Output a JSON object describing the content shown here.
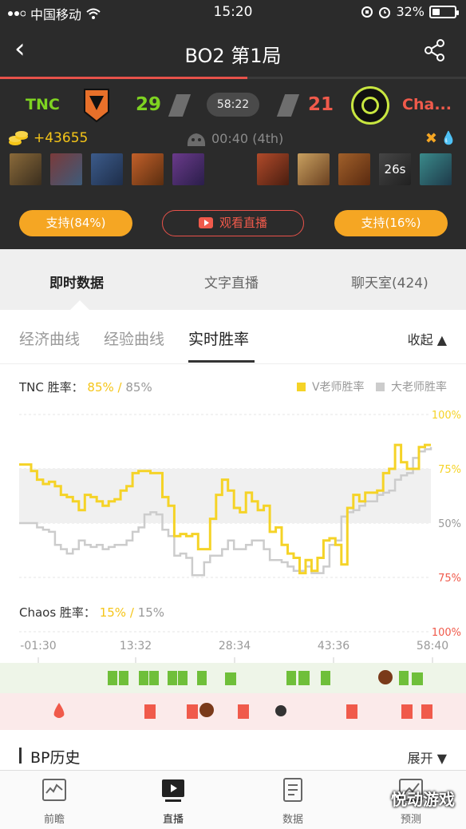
{
  "status_bar": {
    "carrier": "中国移动",
    "time": "15:20",
    "battery": "32%"
  },
  "nav": {
    "title": "BO2   第1局"
  },
  "match": {
    "team_left": "TNC",
    "team_right": "Cha...",
    "score_left": "29",
    "score_right": "21",
    "game_time": "58:22",
    "gold_lead": "+43655",
    "roshan_timer": "00:40 (4th)",
    "dead_timer": "26s"
  },
  "actions": {
    "support_left": "支持(84%)",
    "watch_live": "观看直播",
    "support_right": "支持(16%)"
  },
  "main_tabs": [
    "即时数据",
    "文字直播",
    "聊天室(424)"
  ],
  "sub_tabs": [
    "经济曲线",
    "经验曲线",
    "实时胜率"
  ],
  "collapse_label": "收起",
  "chart_labels": {
    "tnc_label": "TNC 胜率：",
    "tnc_v": "85%",
    "tnc_sep": "/",
    "tnc_d": "85%",
    "chaos_label": "Chaos 胜率：",
    "chaos_v": "15%",
    "chaos_sep": "/",
    "chaos_d": "15%",
    "legend_v": "V老师胜率",
    "legend_d": "大老师胜率"
  },
  "chart_data": {
    "type": "line",
    "y_ticks": [
      "100%",
      "75%",
      "50%",
      "75%",
      "100%"
    ],
    "x_ticks": [
      "-01:30",
      "13:32",
      "28:34",
      "43:36",
      "58:40"
    ],
    "grid": true,
    "series": [
      {
        "name": "V老师胜率",
        "color": "#f5d327",
        "values": [
          77,
          77,
          74,
          70,
          68,
          69,
          67,
          63,
          62,
          60,
          56,
          63,
          62,
          60,
          58,
          60,
          61,
          65,
          67,
          73,
          74,
          74,
          73,
          73,
          62,
          58,
          44,
          45,
          44,
          45,
          38,
          38,
          52,
          63,
          70,
          65,
          57,
          55,
          64,
          60,
          56,
          58,
          46,
          48,
          40,
          36,
          34,
          27,
          33,
          28,
          34,
          42,
          43,
          40,
          31,
          57,
          63,
          60,
          64,
          64,
          65,
          73,
          75,
          86,
          78,
          75,
          75,
          85,
          86,
          86
        ]
      },
      {
        "name": "大老师胜率",
        "color": "#cccccc",
        "values": [
          50,
          50,
          50,
          48,
          47,
          46,
          40,
          38,
          36,
          38,
          42,
          40,
          39,
          40,
          38,
          39,
          40,
          40,
          42,
          46,
          48,
          54,
          55,
          54,
          47,
          44,
          35,
          36,
          34,
          26,
          26,
          32,
          35,
          35,
          38,
          42,
          38,
          38,
          40,
          42,
          42,
          38,
          33,
          33,
          32,
          30,
          28,
          28,
          30,
          27,
          27,
          30,
          40,
          42,
          53,
          55,
          56,
          58,
          60,
          60,
          63,
          64,
          65,
          70,
          72,
          73,
          80,
          83,
          84,
          85
        ]
      }
    ]
  },
  "bp_history": {
    "label": "BP历史",
    "expand_label": "展开"
  },
  "tab_bar": [
    {
      "label": "前瞻",
      "icon": "chart-frame-icon"
    },
    {
      "label": "直播",
      "icon": "play-screen-icon"
    },
    {
      "label": "数据",
      "icon": "document-icon"
    },
    {
      "label": "预测",
      "icon": "trend-icon"
    }
  ],
  "watermark": "悦动游戏",
  "colors": {
    "accent": "#f5a623",
    "radiant": "#7ed321",
    "dire": "#f05a4b",
    "dark_bg": "#2b2b2b"
  }
}
